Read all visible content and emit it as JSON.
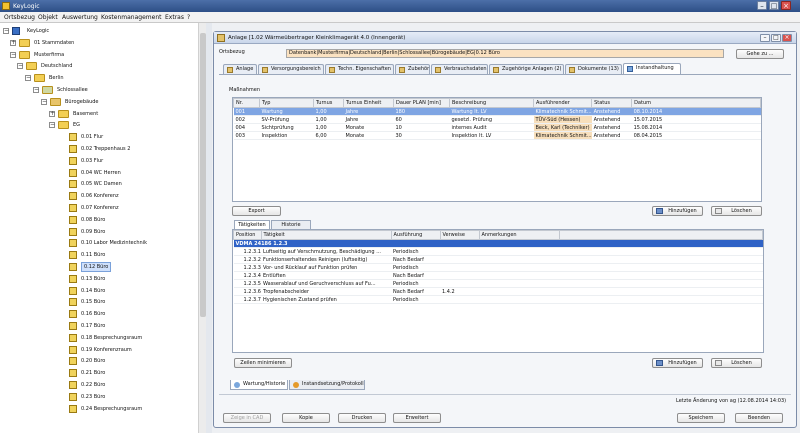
{
  "app": {
    "title": "KeyLogic"
  },
  "menu": [
    "Ortsbezug",
    "Objekt",
    "Auswertung",
    "Kostenmanagement",
    "Extras",
    "?"
  ],
  "tree": [
    {
      "label": "KeyLogic",
      "level": 0,
      "icon": "logo",
      "expanded": true
    },
    {
      "label": "01 Stammdaten",
      "level": 1,
      "icon": "folder",
      "expanded": false
    },
    {
      "label": "Musterfirma",
      "level": 1,
      "icon": "folder",
      "expanded": true
    },
    {
      "label": "Deutschland",
      "level": 2,
      "icon": "folder",
      "expanded": true
    },
    {
      "label": "Berlin",
      "level": 3,
      "icon": "folder",
      "expanded": true
    },
    {
      "label": "Schlossallee",
      "level": 4,
      "icon": "site",
      "expanded": true
    },
    {
      "label": "Bürogebäude",
      "level": 5,
      "icon": "building",
      "expanded": true
    },
    {
      "label": "Basement",
      "level": 6,
      "icon": "folder",
      "expanded": false
    },
    {
      "label": "EG",
      "level": 6,
      "icon": "folder",
      "expanded": true
    },
    {
      "label": "0.01 Flur",
      "level": 7,
      "icon": "room"
    },
    {
      "label": "0.02 Treppenhaus 2",
      "level": 7,
      "icon": "room"
    },
    {
      "label": "0.03 Flur",
      "level": 7,
      "icon": "room"
    },
    {
      "label": "0.04 WC Herren",
      "level": 7,
      "icon": "room"
    },
    {
      "label": "0.05 WC Damen",
      "level": 7,
      "icon": "room"
    },
    {
      "label": "0.06 Konferenz",
      "level": 7,
      "icon": "room"
    },
    {
      "label": "0.07 Konferenz",
      "level": 7,
      "icon": "room"
    },
    {
      "label": "0.08 Büro",
      "level": 7,
      "icon": "room"
    },
    {
      "label": "0.09 Büro",
      "level": 7,
      "icon": "room"
    },
    {
      "label": "0.10 Labor Medizintechnik",
      "level": 7,
      "icon": "room"
    },
    {
      "label": "0.11 Büro",
      "level": 7,
      "icon": "room"
    },
    {
      "label": "0.12 Büro",
      "level": 7,
      "icon": "room",
      "selected": true
    },
    {
      "label": "0.13 Büro",
      "level": 7,
      "icon": "room"
    },
    {
      "label": "0.14 Büro",
      "level": 7,
      "icon": "room"
    },
    {
      "label": "0.15 Büro",
      "level": 7,
      "icon": "room"
    },
    {
      "label": "0.16 Büro",
      "level": 7,
      "icon": "room"
    },
    {
      "label": "0.17 Büro",
      "level": 7,
      "icon": "room"
    },
    {
      "label": "0.18 Besprechungsraum",
      "level": 7,
      "icon": "room"
    },
    {
      "label": "0.19 Konferenzraum",
      "level": 7,
      "icon": "room"
    },
    {
      "label": "0.20 Büro",
      "level": 7,
      "icon": "room"
    },
    {
      "label": "0.21 Büro",
      "level": 7,
      "icon": "room"
    },
    {
      "label": "0.22 Büro",
      "level": 7,
      "icon": "room"
    },
    {
      "label": "0.23 Büro",
      "level": 7,
      "icon": "room"
    },
    {
      "label": "0.24 Besprechungsraum",
      "level": 7,
      "icon": "room"
    }
  ],
  "window": {
    "title": "Anlage [1.02 Wärmeübertrager Kleinklimagerät 4.0 (Innengerät)",
    "ortsbezug_label": "Ortsbezug",
    "ortsbezug_value": "Datenbank|Musterfirma|Deutschland|Berlin|Schlossallee|Bürogebäude|EG|0.12 Büro",
    "goto_label": "Gehe zu ...",
    "tabs": [
      "Anlage",
      "Versorgungsbereich",
      "Techn. Eigenschaften",
      "Zubehör",
      "Verbrauchsdaten",
      "Zugehörige Anlagen (2)",
      "Dokumente (13)",
      "Instandhaltung"
    ],
    "active_tab": 7
  },
  "massnahmen": {
    "label": "Maßnahmen",
    "columns": [
      "Nr.",
      "Typ",
      "Turnus",
      "Turnus Einheit",
      "Dauer PLAN [min]",
      "Beschreibung",
      "Ausführender",
      "Status",
      "Datum"
    ],
    "rows": [
      [
        "001",
        "Wartung",
        "1,00",
        "Jahre",
        "180",
        "Wartung lt. LV",
        "Klimatechnik Schmit...",
        "Anstehend",
        "08.10.2014"
      ],
      [
        "002",
        "SV-Prüfung",
        "1,00",
        "Jahre",
        "60",
        "gesetzl. Prüfung",
        "TÜV-Süd (Hessen)",
        "Anstehend",
        "15.07.2015"
      ],
      [
        "004",
        "Sichtprüfung",
        "1,00",
        "Monate",
        "10",
        "internes Audit",
        "Beck, Karl (Techniker)",
        "Anstehend",
        "15.08.2014"
      ],
      [
        "003",
        "Inspektion",
        "6,00",
        "Monate",
        "30",
        "Inspektion lt. LV",
        "Klimatechnik Schmit...",
        "Anstehend",
        "08.04.2015"
      ]
    ],
    "export_label": "Export",
    "add_label": "Hinzufügen",
    "delete_label": "Löschen"
  },
  "taetigkeiten": {
    "tabs": [
      "Tätigkeiten",
      "Historie"
    ],
    "columns": [
      "Position",
      "Tätigkeit",
      "Ausführung",
      "Verweise",
      "Anmerkungen"
    ],
    "group": "VDMA 24186 1.2.3",
    "rows": [
      [
        "1.2.3.1",
        "Luftseitig auf Verschmutzung, Beschädigung ...",
        "Periodisch",
        "",
        ""
      ],
      [
        "1.2.3.2",
        "Funktionserhaltendes Reinigen (luftseitig)",
        "Nach Bedarf",
        "",
        ""
      ],
      [
        "1.2.3.3",
        "Vor- und Rücklauf auf Funktion prüfen",
        "Periodisch",
        "",
        ""
      ],
      [
        "1.2.3.4",
        "Entlüften",
        "Nach Bedarf",
        "",
        ""
      ],
      [
        "1.2.3.5",
        "Wasserablauf und Geruchverschluss auf Fu...",
        "Periodisch",
        "",
        ""
      ],
      [
        "1.2.3.6",
        "Tropfenabscheider",
        "Nach Bedarf",
        "1.4.2",
        ""
      ],
      [
        "1.2.3.7",
        "Hygienischen Zustand prüfen",
        "Periodisch",
        "",
        ""
      ]
    ],
    "minimize_label": "Zeilen minimieren",
    "add_label": "Hinzufügen",
    "delete_label": "Löschen"
  },
  "bottom_tabs": [
    "Wartung/Historie",
    "Instandsetzung/Protokoll"
  ],
  "footer": {
    "last_change": "Letzte Änderung von ag (12.08.2014 14:03)",
    "buttons": [
      "Zeige in CAD",
      "Kopie",
      "Drucken",
      "Erweitert"
    ],
    "save_label": "Speichern",
    "close_label": "Beenden"
  }
}
